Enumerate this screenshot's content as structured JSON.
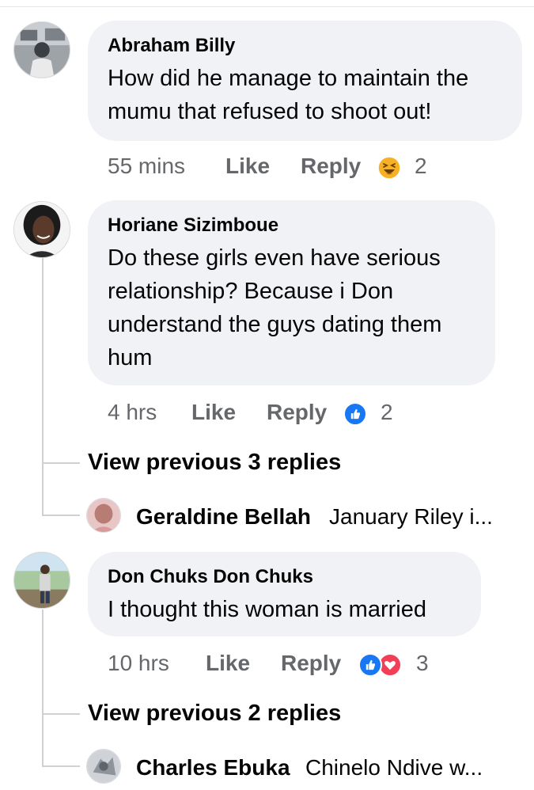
{
  "comments": [
    {
      "author": "Abraham Billy",
      "text_lines": [
        "How did he manage to maintain the",
        "mumu that refused to shoot out!"
      ],
      "time": "55 mins",
      "like_label": "Like",
      "reply_label": "Reply",
      "reactions": [
        "haha"
      ],
      "reaction_count": "2"
    },
    {
      "author": "Horiane Sizimboue",
      "text_lines": [
        "Do these girls even have serious",
        "relationship? Because i Don",
        "understand the guys dating them",
        "hum"
      ],
      "time": "4 hrs",
      "like_label": "Like",
      "reply_label": "Reply",
      "reactions": [
        "like"
      ],
      "reaction_count": "2",
      "view_replies": "View previous 3 replies",
      "last_reply": {
        "author": "Geraldine Bellah",
        "text": "January Riley i..."
      }
    },
    {
      "author": "Don Chuks Don Chuks",
      "text_lines": [
        "I thought this woman is married"
      ],
      "time": "10 hrs",
      "like_label": "Like",
      "reply_label": "Reply",
      "reactions": [
        "like",
        "love"
      ],
      "reaction_count": "3",
      "view_replies": "View previous 2 replies",
      "last_reply": {
        "author": "Charles Ebuka",
        "text": "Chinelo Ndive w..."
      }
    }
  ],
  "colors": {
    "bubble": "#f0f2f5",
    "meta_text": "#65676b",
    "like_blue": "#1877f2",
    "love_red": "#f33e58",
    "haha_yellow": "#f7b125",
    "thread_line": "#ced0d4"
  }
}
